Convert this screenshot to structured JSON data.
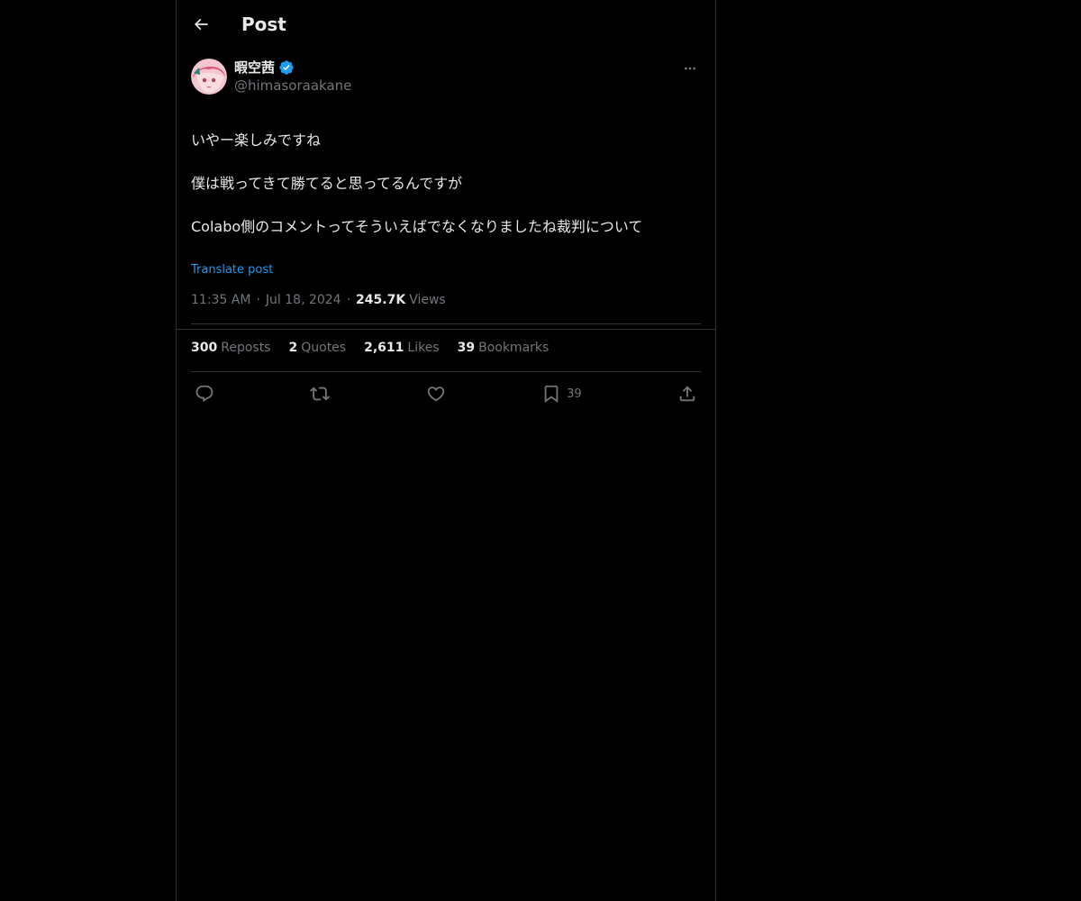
{
  "header": {
    "title": "Post",
    "back_icon": "arrow-left-icon"
  },
  "author": {
    "display_name": "暇空茜",
    "handle": "@himasoraakane",
    "verified": true,
    "verified_color": "#1d9bf0"
  },
  "post": {
    "lines": [
      "いやー楽しみですね",
      "僕は戦ってきて勝てると思ってるんですが",
      "Colabo側のコメントってそういえばでなくなりましたね裁判について"
    ],
    "translate_label": "Translate post",
    "time": "11:35 AM",
    "date": "Jul 18, 2024",
    "views_count": "245.7K",
    "views_label": "Views"
  },
  "stats": {
    "reposts": {
      "count": "300",
      "label": "Reposts"
    },
    "quotes": {
      "count": "2",
      "label": "Quotes"
    },
    "likes": {
      "count": "2,611",
      "label": "Likes"
    },
    "bookmarks": {
      "count": "39",
      "label": "Bookmarks"
    }
  },
  "actions": {
    "reply_icon": "reply-icon",
    "repost_icon": "repost-icon",
    "like_icon": "heart-icon",
    "bookmark_icon": "bookmark-icon",
    "bookmark_count": "39",
    "share_icon": "share-icon"
  },
  "colors": {
    "background": "#000000",
    "text_primary": "#e7e9ea",
    "text_secondary": "#71767b",
    "accent": "#1d9bf0",
    "border": "#2f3336"
  }
}
